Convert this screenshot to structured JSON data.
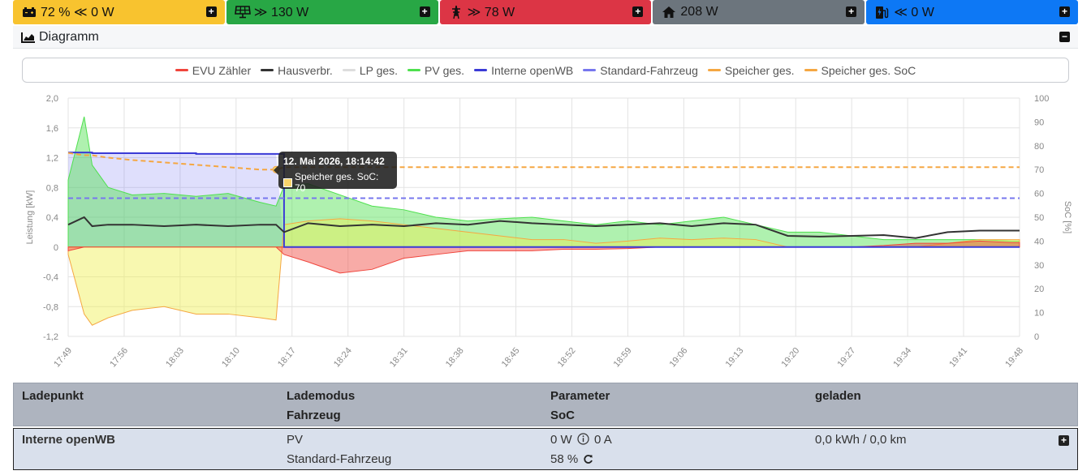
{
  "tiles": [
    {
      "name": "battery",
      "text": "72 % ≪ 0 W",
      "icon": "car-battery-icon"
    },
    {
      "name": "pv",
      "text": "≫ 130 W",
      "icon": "solar-panel-icon"
    },
    {
      "name": "grid",
      "text": "≫ 78 W",
      "icon": "power-tower-icon"
    },
    {
      "name": "house",
      "text": "208 W",
      "icon": "house-icon"
    },
    {
      "name": "charge",
      "text": "≪ 0 W",
      "icon": "charging-station-icon"
    }
  ],
  "diagram": {
    "title": "Diagramm",
    "tooltip": {
      "title": "12. Mai 2026, 18:14:42",
      "line": "Speicher ges. SoC: 70"
    }
  },
  "chart_data": {
    "type": "line",
    "legend": [
      {
        "name": "EVU Zähler",
        "color": "#f0453c"
      },
      {
        "name": "Hausverbr.",
        "color": "#333333"
      },
      {
        "name": "LP ges.",
        "color": "#dddddd"
      },
      {
        "name": "PV ges.",
        "color": "#4ee04e"
      },
      {
        "name": "Interne openWB",
        "color": "#3b3bd6"
      },
      {
        "name": "Standard-Fahrzeug",
        "color": "#7777ee"
      },
      {
        "name": "Speicher ges.",
        "color": "#f5a742"
      },
      {
        "name": "Speicher ges. SoC",
        "color": "#f5a742"
      }
    ],
    "ylabel": "Leistung [kW]",
    "y2label": "SoC [%]",
    "ylim": [
      -1.2,
      2.0
    ],
    "y2lim": [
      0,
      100
    ],
    "yticks": [
      "2,0",
      "1,6",
      "1,2",
      "0,8",
      "0,4",
      "0",
      "-0,4",
      "-0,8",
      "-1,2"
    ],
    "y2ticks": [
      "100",
      "90",
      "80",
      "70",
      "60",
      "50",
      "40",
      "30",
      "20",
      "10",
      "0"
    ],
    "xticks": [
      "17:49",
      "17:56",
      "18:03",
      "18:10",
      "18:17",
      "18:24",
      "18:31",
      "18:38",
      "18:45",
      "18:52",
      "18:59",
      "19:06",
      "19:13",
      "19:20",
      "19:27",
      "19:34",
      "19:41",
      "19:48"
    ],
    "x_minutes": [
      0,
      2,
      3,
      5,
      8,
      12,
      16,
      20,
      24,
      26,
      27,
      30,
      34,
      38,
      42,
      46,
      50,
      54,
      58,
      62,
      66,
      70,
      74,
      78,
      82,
      86,
      90,
      94,
      98,
      102,
      106,
      110,
      114,
      118,
      119
    ],
    "pv_kw": [
      0.9,
      1.75,
      1.1,
      0.8,
      0.7,
      0.72,
      0.68,
      0.72,
      0.6,
      0.55,
      0.82,
      0.85,
      0.7,
      0.55,
      0.5,
      0.4,
      0.35,
      0.38,
      0.4,
      0.35,
      0.3,
      0.35,
      0.3,
      0.35,
      0.4,
      0.3,
      0.2,
      0.2,
      0.15,
      0.1,
      0.1,
      0.1,
      0.1,
      0.08,
      0.08
    ],
    "house_kw": [
      0.3,
      0.4,
      0.28,
      0.3,
      0.3,
      0.28,
      0.3,
      0.28,
      0.3,
      0.3,
      0.2,
      0.32,
      0.28,
      0.3,
      0.28,
      0.32,
      0.3,
      0.35,
      0.32,
      0.3,
      0.28,
      0.3,
      0.32,
      0.28,
      0.32,
      0.3,
      0.15,
      0.14,
      0.15,
      0.16,
      0.12,
      0.2,
      0.22,
      0.22,
      0.22
    ],
    "grid_kw": [
      -0.05,
      0.0,
      0.0,
      0.0,
      0.0,
      0.0,
      0.0,
      0.0,
      0.0,
      0.0,
      -0.1,
      -0.2,
      -0.35,
      -0.3,
      -0.15,
      -0.1,
      -0.05,
      -0.05,
      -0.05,
      -0.03,
      -0.03,
      -0.02,
      0.0,
      0.0,
      0.0,
      0.0,
      0.0,
      0.0,
      0.0,
      0.02,
      0.05,
      0.05,
      0.08,
      0.06,
      0.06
    ],
    "battery_kw": [
      -0.1,
      -0.9,
      -1.05,
      -0.95,
      -0.85,
      -0.8,
      -0.9,
      -0.9,
      -0.95,
      -0.98,
      0.3,
      0.35,
      0.38,
      0.35,
      0.3,
      0.25,
      0.2,
      0.15,
      0.1,
      0.1,
      0.05,
      0.08,
      0.12,
      0.1,
      0.12,
      0.1,
      0.0,
      0.0,
      0.0,
      0.0,
      0.0,
      0.05,
      0.1,
      0.1,
      0.1
    ],
    "interne_openwb_kw": [
      1.27,
      1.27,
      1.26,
      1.26,
      1.26,
      1.26,
      1.25,
      1.25,
      1.25,
      1.25,
      0.0,
      0.0,
      0.0,
      0.0,
      0.0,
      0.0,
      0.0,
      0.0,
      0.0,
      0.0,
      0.0,
      0.0,
      0.0,
      0.0,
      0.0,
      0.0,
      0.0,
      0.0,
      0.0,
      0.0,
      0.0,
      0.0,
      0.0,
      0.0,
      0.0
    ],
    "speicher_soc_pct": [
      77,
      76,
      76,
      75,
      74,
      73,
      72,
      71,
      70,
      70,
      71,
      71,
      71,
      71,
      71,
      71,
      71,
      71,
      71,
      71,
      71,
      71,
      71,
      71,
      71,
      71,
      71,
      71,
      71,
      71,
      71,
      71,
      71,
      71,
      71
    ],
    "fahrzeug_soc_pct": [
      58,
      58,
      58,
      58,
      58,
      58,
      58,
      58,
      58,
      58,
      58,
      58,
      58,
      58,
      58,
      58,
      58,
      58,
      58,
      58,
      58,
      58,
      58,
      58,
      58,
      58,
      58,
      58,
      58,
      58,
      58,
      58,
      58,
      58,
      58
    ]
  },
  "table": {
    "headers": {
      "ladepunkt": "Ladepunkt",
      "lademodus": "Lademodus",
      "fahrzeug": "Fahrzeug",
      "parameter": "Parameter",
      "soc": "SoC",
      "geladen": "geladen"
    },
    "row": {
      "name": "Interne openWB",
      "mode": "PV",
      "vehicle": "Standard-Fahrzeug",
      "power": "0 W",
      "current": "0 A",
      "soc": "58 %",
      "charged": "0,0 kWh / 0,0 km"
    }
  }
}
